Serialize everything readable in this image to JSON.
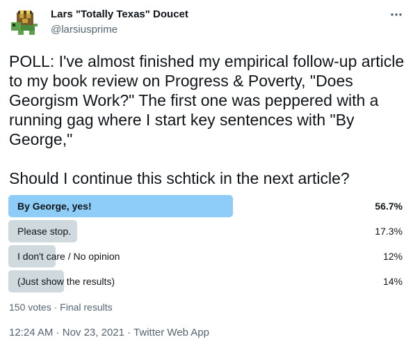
{
  "author": {
    "name": "Lars \"Totally Texas\" Doucet",
    "handle": "@larsiusprime",
    "avatar_icon": "pixel-turtle-avatar-icon"
  },
  "tweet": {
    "paragraph1": "POLL: I've almost finished my empirical follow-up article to my book review on Progress & Poverty, \"Does Georgism Work?\" The first one was peppered with a running gag where I start key sentences with \"By George,\"",
    "paragraph2": "Should I continue this schtick in the next article?"
  },
  "poll": {
    "options": [
      {
        "label": "By George, yes!",
        "percent_text": "56.7%",
        "percent": 56.7,
        "winner": true
      },
      {
        "label": "Please stop.",
        "percent_text": "17.3%",
        "percent": 17.3,
        "winner": false
      },
      {
        "label": "I don't care / No opinion",
        "percent_text": "12%",
        "percent": 12,
        "winner": false
      },
      {
        "label": "(Just show the results)",
        "percent_text": "14%",
        "percent": 14,
        "winner": false
      }
    ],
    "summary": "150 votes · Final results"
  },
  "meta": {
    "time": "12:24 AM",
    "date": "Nov 23, 2021",
    "source": "Twitter Web App",
    "separator": " · "
  },
  "colors": {
    "winner_bar": "#8ecdf8",
    "loser_bar": "#cfd9de",
    "secondary_text": "#536471",
    "primary_text": "#0f1419"
  }
}
